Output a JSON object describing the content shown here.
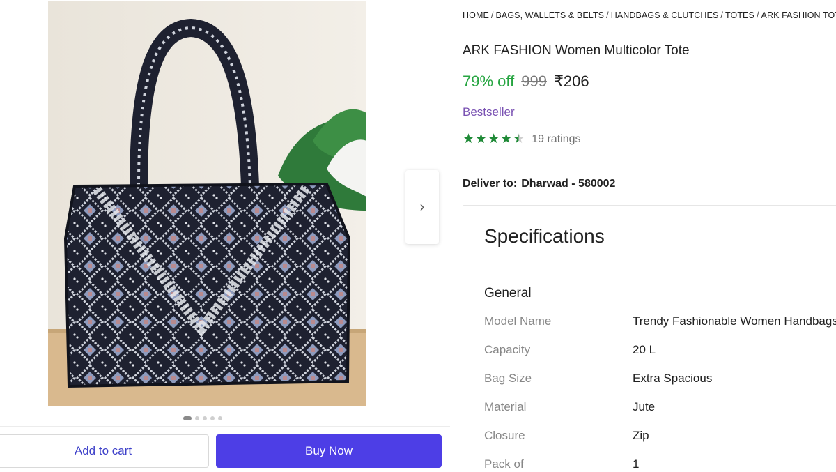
{
  "breadcrumb": [
    "HOME",
    "BAGS, WALLETS & BELTS",
    "HANDBAGS & CLUTCHES",
    "TOTES",
    "ARK FASHION TOTES"
  ],
  "product": {
    "title": "ARK FASHION Women Multicolor Tote",
    "discount": "79% off",
    "mrp": "999",
    "price": "₹206",
    "badge": "Bestseller",
    "rating_value": 4.5,
    "ratings_text": "19 ratings",
    "image_index": 1,
    "image_count": 5
  },
  "delivery": {
    "label": "Deliver to:",
    "location": "Dharwad - 580002"
  },
  "actions": {
    "add_to_cart": "Add to cart",
    "buy_now": "Buy Now"
  },
  "specs": {
    "heading": "Specifications",
    "group": "General",
    "rows": [
      {
        "key": "Model Name",
        "value": "Trendy Fashionable Women Handbags"
      },
      {
        "key": "Capacity",
        "value": "20 L"
      },
      {
        "key": "Bag Size",
        "value": "Extra Spacious"
      },
      {
        "key": "Material",
        "value": "Jute"
      },
      {
        "key": "Closure",
        "value": "Zip"
      },
      {
        "key": "Pack of",
        "value": "1"
      }
    ]
  },
  "colors": {
    "discount": "#26a541",
    "badge": "#7a52b3",
    "star": "#1f8a37",
    "buy_button": "#4d3ee6",
    "cart_text": "#3d40c9"
  },
  "icons": {
    "next": "chevron-right-icon",
    "star": "star-icon"
  }
}
